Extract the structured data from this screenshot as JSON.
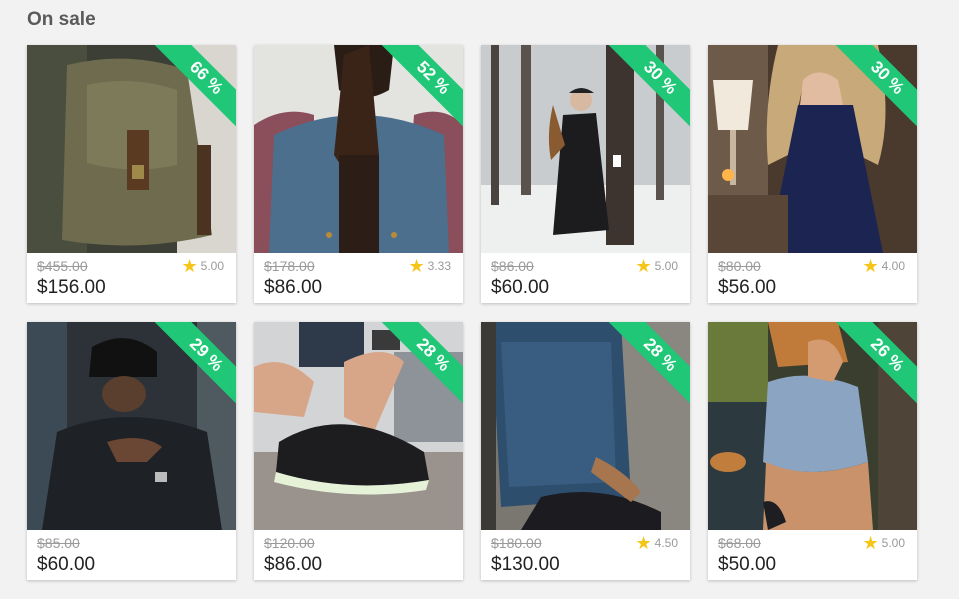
{
  "section": {
    "title": "On sale"
  },
  "products": [
    {
      "discount": "66 %",
      "old_price": "$455.00",
      "new_price": "$156.00",
      "rating": "5.00",
      "image": "backpack-person-photo"
    },
    {
      "discount": "52 %",
      "old_price": "$178.00",
      "new_price": "$86.00",
      "rating": "3.33",
      "image": "denim-vest-man-photo"
    },
    {
      "discount": "30 %",
      "old_price": "$86.00",
      "new_price": "$60.00",
      "rating": "5.00",
      "image": "woman-snow-forest-photo"
    },
    {
      "discount": "30 %",
      "old_price": "$80.00",
      "new_price": "$56.00",
      "rating": "4.00",
      "image": "woman-blue-dress-photo"
    },
    {
      "discount": "29 %",
      "old_price": "$85.00",
      "new_price": "$60.00",
      "rating": null,
      "image": "man-black-cap-photo"
    },
    {
      "discount": "28 %",
      "old_price": "$120.00",
      "new_price": "$86.00",
      "rating": null,
      "image": "led-sneakers-photo"
    },
    {
      "discount": "28 %",
      "old_price": "$180.00",
      "new_price": "$130.00",
      "rating": "4.50",
      "image": "patterned-shirt-man-photo"
    },
    {
      "discount": "26 %",
      "old_price": "$68.00",
      "new_price": "$50.00",
      "rating": "5.00",
      "image": "woman-crop-top-photo"
    }
  ],
  "colors": {
    "ribbon": "#1fc777",
    "star": "#f5c518",
    "background": "#f2f2f2"
  }
}
